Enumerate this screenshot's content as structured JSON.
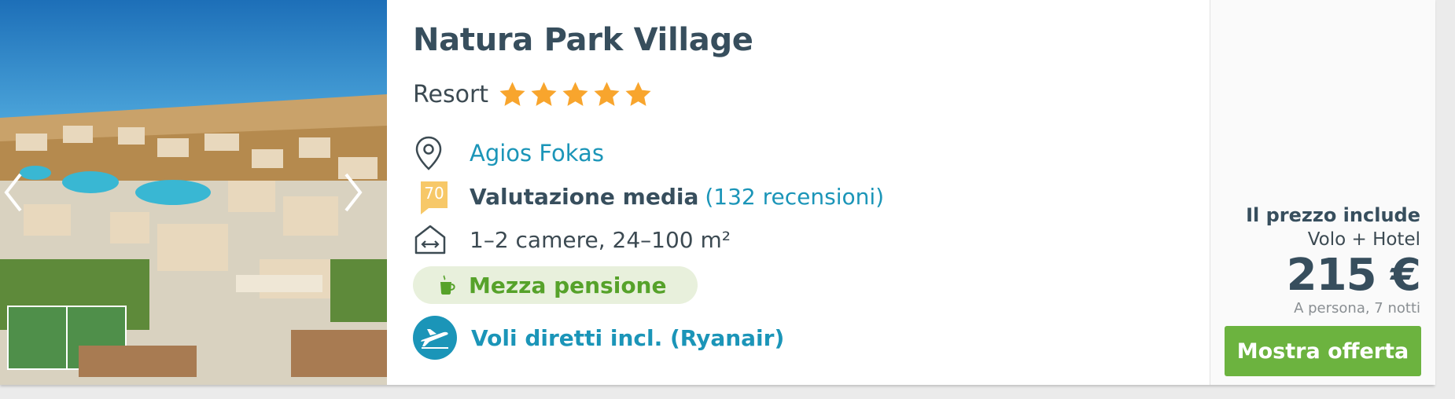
{
  "hotel": {
    "name": "Natura Park Village",
    "type": "Resort",
    "stars": 5,
    "location": "Agios Fokas",
    "rating": {
      "score": "70",
      "label": "Valutazione media",
      "reviews": "(132 recensioni)"
    },
    "rooms": "1–2 camere,  24–100 m²",
    "board": "Mezza pensione",
    "flight": "Voli diretti incl. (Ryanair)"
  },
  "pricing": {
    "includes_label": "Il prezzo include",
    "includes_value": "Volo + Hotel",
    "price": "215 €",
    "price_note": "A persona, 7 notti",
    "cta_label": "Mostra offerta"
  },
  "icons": {
    "star": "star-icon",
    "location": "location-pin-icon",
    "rating": "rating-flag-icon",
    "room": "room-size-icon",
    "board": "coffee-cup-icon",
    "flight": "airplane-icon",
    "prev": "chevron-left-icon",
    "next": "chevron-right-icon"
  },
  "colors": {
    "title": "#374e5d",
    "link": "#1b95b8",
    "star": "#f8a52d",
    "board_bg": "#e8f0dc",
    "board_text": "#56a22a",
    "cta_bg": "#6cb33f",
    "rating_badge": "#f7c868"
  }
}
